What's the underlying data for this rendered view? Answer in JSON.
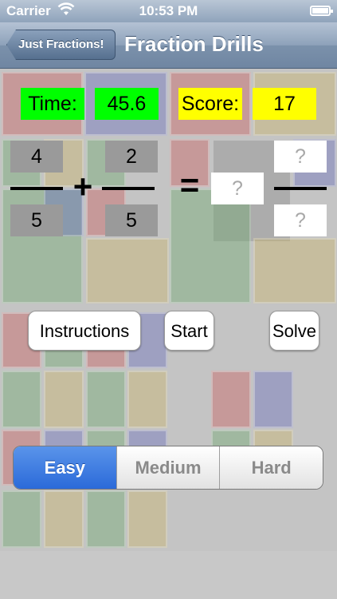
{
  "status_bar": {
    "carrier": "Carrier",
    "time": "10:53 PM"
  },
  "nav": {
    "back_label": "Just Fractions!",
    "title": "Fraction Drills"
  },
  "game": {
    "time_label": "Time:",
    "time_value": "45.6",
    "score_label": "Score:",
    "score_value": "17",
    "fraction_a": {
      "numerator": "4",
      "denominator": "5"
    },
    "operator": "+",
    "fraction_b": {
      "numerator": "2",
      "denominator": "5"
    },
    "equals": "=",
    "answer": {
      "whole": "?",
      "numerator": "?",
      "denominator": "?"
    }
  },
  "buttons": {
    "instructions": "Instructions",
    "start": "Start",
    "solve": "Solve"
  },
  "difficulty": {
    "options": [
      "Easy",
      "Medium",
      "Hard"
    ],
    "selected": "Easy"
  },
  "colors": {
    "accent": "#2b6ad9",
    "timer_bg": "#00ff00",
    "score_bg": "#ffff00"
  }
}
